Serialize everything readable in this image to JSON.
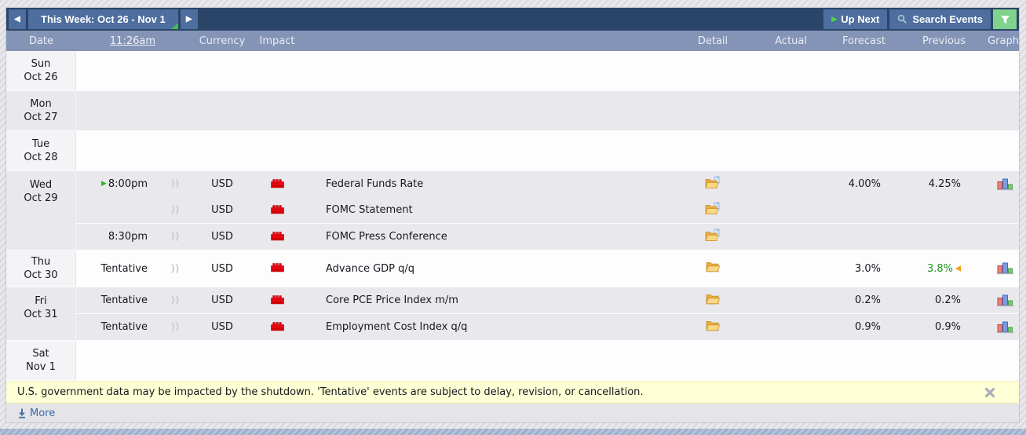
{
  "topbar": {
    "title": "This Week: Oct 26 - Nov 1",
    "prev_arrow": "◀",
    "next_arrow": "▶",
    "up_next_label": "Up Next",
    "search_label": "Search Events"
  },
  "header": {
    "date": "Date",
    "time": "11:26am",
    "currency": "Currency",
    "impact": "Impact",
    "detail": "Detail",
    "actual": "Actual",
    "forecast": "Forecast",
    "previous": "Previous",
    "graph": "Graph"
  },
  "days": [
    {
      "day": "Sun",
      "date": "Oct 26",
      "shade": "light",
      "events": []
    },
    {
      "day": "Mon",
      "date": "Oct 27",
      "shade": "dark",
      "events": []
    },
    {
      "day": "Tue",
      "date": "Oct 28",
      "shade": "light",
      "events": []
    },
    {
      "day": "Wed",
      "date": "Oct 29",
      "shade": "dark",
      "events": [
        {
          "time": "8:00pm",
          "up_next": true,
          "alert": true,
          "currency": "USD",
          "impact": "high",
          "name": "Federal Funds Rate",
          "detail": "folder-doc",
          "actual": "",
          "forecast": "4.00%",
          "previous": "4.25%",
          "revised": false,
          "graph": true,
          "separator": false
        },
        {
          "time": "",
          "up_next": false,
          "alert": true,
          "currency": "USD",
          "impact": "high",
          "name": "FOMC Statement",
          "detail": "folder-doc",
          "actual": "",
          "forecast": "",
          "previous": "",
          "revised": false,
          "graph": false,
          "separator": false
        },
        {
          "time": "8:30pm",
          "up_next": false,
          "alert": true,
          "currency": "USD",
          "impact": "high",
          "name": "FOMC Press Conference",
          "detail": "folder-doc",
          "actual": "",
          "forecast": "",
          "previous": "",
          "revised": false,
          "graph": false,
          "separator": true
        }
      ]
    },
    {
      "day": "Thu",
      "date": "Oct 30",
      "shade": "light",
      "events": [
        {
          "time": "Tentative",
          "up_next": false,
          "alert": true,
          "currency": "USD",
          "impact": "high",
          "name": "Advance GDP q/q",
          "detail": "folder",
          "actual": "",
          "forecast": "3.0%",
          "previous": "3.8%",
          "revised": true,
          "graph": true,
          "separator": false
        }
      ]
    },
    {
      "day": "Fri",
      "date": "Oct 31",
      "shade": "dark",
      "events": [
        {
          "time": "Tentative",
          "up_next": false,
          "alert": true,
          "currency": "USD",
          "impact": "high",
          "name": "Core PCE Price Index m/m",
          "detail": "folder",
          "actual": "",
          "forecast": "0.2%",
          "previous": "0.2%",
          "revised": false,
          "graph": true,
          "separator": false
        },
        {
          "time": "Tentative",
          "up_next": false,
          "alert": true,
          "currency": "USD",
          "impact": "high",
          "name": "Employment Cost Index q/q",
          "detail": "folder",
          "actual": "",
          "forecast": "0.9%",
          "previous": "0.9%",
          "revised": false,
          "graph": true,
          "separator": true
        }
      ]
    },
    {
      "day": "Sat",
      "date": "Nov 1",
      "shade": "light",
      "events": []
    }
  ],
  "notice": {
    "text": "U.S. government data may be impacted by the shutdown. 'Tentative' events are subject to delay, revision, or cancellation."
  },
  "footer": {
    "more_label": "More"
  },
  "colors": {
    "topbar_bg": "#2b4568",
    "button_bg": "#4d6e9f",
    "header_bg": "#8494b6",
    "filter_green": "#7fd38d",
    "up_next_green": "#2eb82e",
    "impact_high_red": "#e20613",
    "revised_green": "#1f9622",
    "revision_orange": "#f5a020",
    "notice_bg": "#ffffd6"
  }
}
